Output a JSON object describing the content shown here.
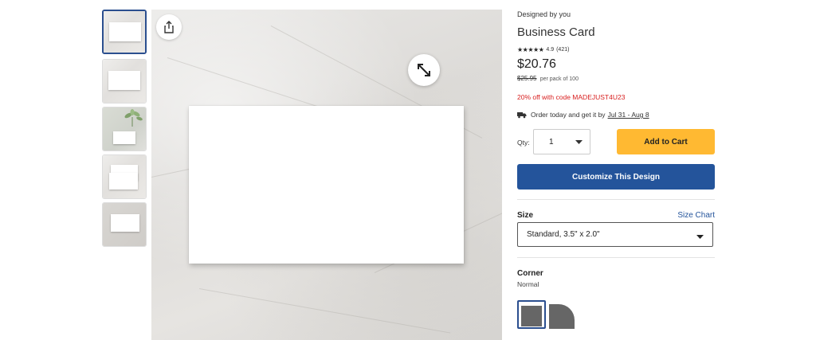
{
  "product": {
    "designed_by": "Designed by you",
    "title": "Business Card",
    "stars": "★★★★★",
    "rating": "4.9",
    "reviews": "(421)",
    "price": "$20.76",
    "old_price": "$25.95",
    "per_pack": "per pack of 100",
    "promo": "20% off with code MADEJUST4U23",
    "ship_text": "Order today and get it by",
    "ship_date": "Jul 31 - Aug 8"
  },
  "purchase": {
    "qty_label": "Qty:",
    "qty_value": "1",
    "add_to_cart": "Add to Cart",
    "customize": "Customize This Design"
  },
  "options": {
    "size_label": "Size",
    "size_chart": "Size Chart",
    "size_selected": "Standard, 3.5\" x 2.0\"",
    "corner_label": "Corner",
    "corner_value": "Normal"
  },
  "colors": {
    "add_to_cart_bg": "#ffb932",
    "customize_bg": "#24549b",
    "promo_text": "#d81e1e",
    "link": "#24549b"
  },
  "icons": [
    "share-icon",
    "expand-icon",
    "truck-icon",
    "chevron-down-icon"
  ]
}
